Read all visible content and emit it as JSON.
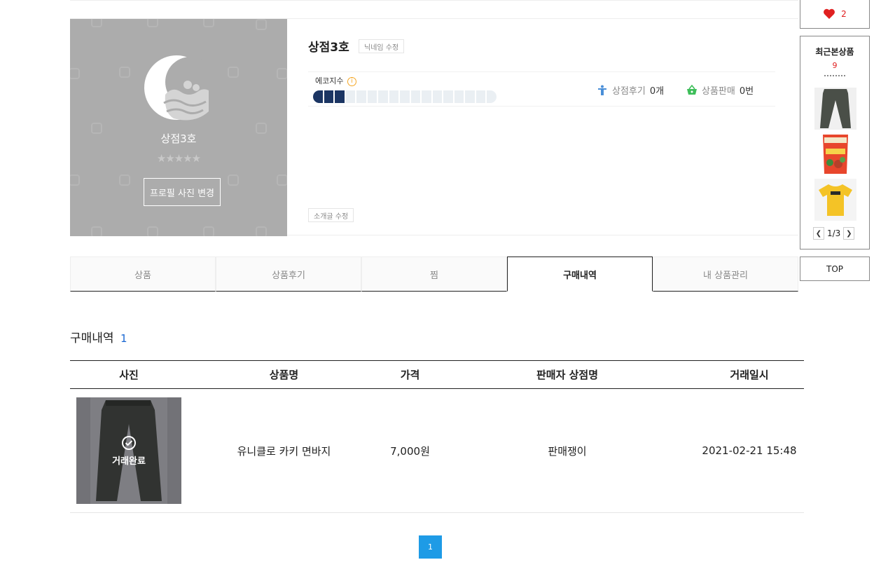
{
  "profile": {
    "card_name": "상점3호",
    "stars": "★★★★★",
    "change_photo_label": "프로필 사진 변경",
    "shop_name": "상점3호",
    "nickname_edit_label": "닉네임 수정",
    "eco_label": "에코지수",
    "eco_info_icon": "i",
    "eco_level": 3,
    "eco_total": 17,
    "review_label": "상점후기",
    "review_count": "0개",
    "sales_label": "상품판매",
    "sales_count": "0번",
    "intro_edit_label": "소개글 수정"
  },
  "tabs": [
    {
      "label": "상품",
      "active": false
    },
    {
      "label": "상품후기",
      "active": false
    },
    {
      "label": "찜",
      "active": false
    },
    {
      "label": "구매내역",
      "active": true
    },
    {
      "label": "내 상품관리",
      "active": false
    }
  ],
  "purchases": {
    "title": "구매내역",
    "count": "1",
    "columns": [
      "사진",
      "상품명",
      "가격",
      "판매자 상점명",
      "거래일시"
    ],
    "rows": [
      {
        "status": "거래완료",
        "product": "유니클로 카키 면바지",
        "price": "7,000원",
        "seller": "판매쟁이",
        "date": "2021-02-21 15:48"
      }
    ]
  },
  "pagination": {
    "current": "1"
  },
  "sidebar": {
    "like_count": "2",
    "recent_title": "최근본상품",
    "recent_count": "9",
    "recent_page": "1/3",
    "top_label": "TOP",
    "recent_items": [
      "pants-thumbnail",
      "snack-bag-thumbnail",
      "yellow-tshirt-thumbnail"
    ]
  },
  "colors": {
    "accent_blue": "#1e9be6",
    "eco_navy": "#1b3563",
    "like_red": "#e02020",
    "profile_gray": "#acacac"
  }
}
